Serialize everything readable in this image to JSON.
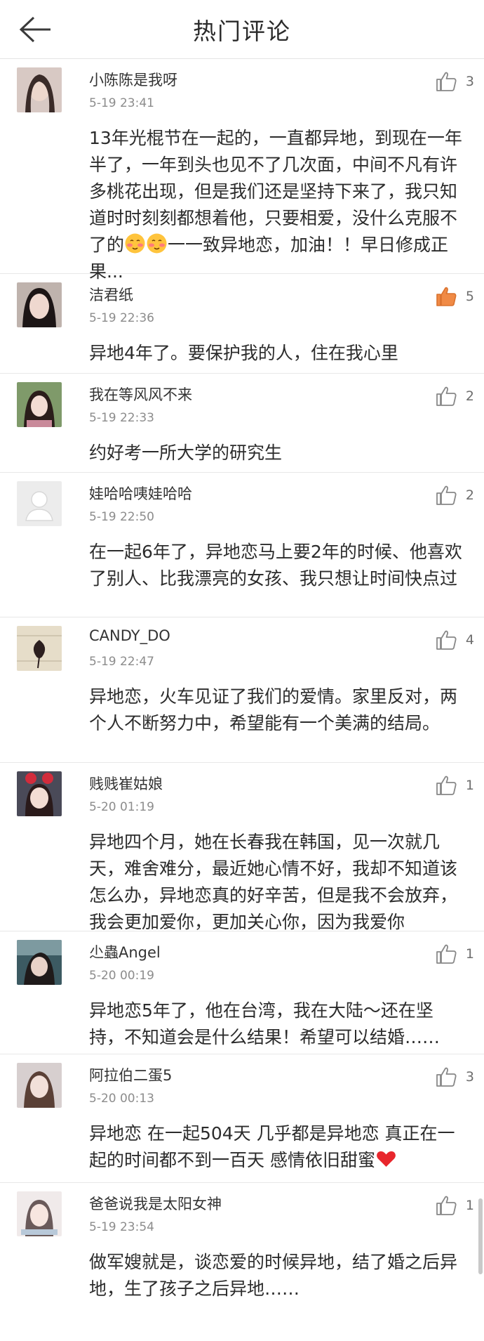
{
  "header": {
    "title": "热门评论"
  },
  "colors": {
    "like_active": "#f08a45",
    "like_inactive": "#888888"
  },
  "comments": [
    {
      "name": "小陈陈是我呀",
      "time": "5-19 23:41",
      "likes": "3",
      "liked": false,
      "text_a": "13年光棍节在一起的，一直都异地，到现在一年半了，一年到头也见不了几次面，中间不凡有许多桃花出现，但是我们还是坚持下来了，我只知道时时刻刻都想着他，只要相爱，没什么克服不了的",
      "text_b": "一一致异地恋，加油！！早日修成正果..."
    },
    {
      "name": "洁君纸",
      "time": "5-19 22:36",
      "likes": "5",
      "liked": true,
      "text": "异地4年了。要保护我的人，住在我心里"
    },
    {
      "name": "我在等风风不来",
      "time": "5-19 22:33",
      "likes": "2",
      "liked": false,
      "text": "约好考一所大学的研究生"
    },
    {
      "name": "娃哈哈咦娃哈哈",
      "time": "5-19 22:50",
      "likes": "2",
      "liked": false,
      "text": "在一起6年了，异地恋马上要2年的时候、他喜欢了别人、比我漂亮的女孩、我只想让时间快点过"
    },
    {
      "name": "CANDY_DO",
      "time": "5-19 22:47",
      "likes": "4",
      "liked": false,
      "text": "异地恋，火车见证了我们的爱情。家里反对，两个人不断努力中，希望能有一个美满的结局。"
    },
    {
      "name": "贱贱崔姑娘",
      "time": "5-20 01:19",
      "likes": "1",
      "liked": false,
      "text": "异地四个月，她在长春我在韩国，见一次就几天，难舍难分，最近她心情不好，我却不知道该怎么办，异地恋真的好辛苦，但是我不会放弃，我会更加爱你，更加关心你，因为我爱你"
    },
    {
      "name": "尐蟲Angel",
      "time": "5-20 00:19",
      "likes": "1",
      "liked": false,
      "text": "异地恋5年了，他在台湾，我在大陆～还在坚持，不知道会是什么结果！希望可以结婚……"
    },
    {
      "name": "阿拉伯二蛋5",
      "time": "5-20 00:13",
      "likes": "3",
      "liked": false,
      "text": "异地恋 在一起504天 几乎都是异地恋 真正在一起的时间都不到一百天 感情依旧甜蜜"
    },
    {
      "name": "爸爸说我是太阳女神",
      "time": "5-19 23:54",
      "likes": "1",
      "liked": false,
      "text": "做军嫂就是，谈恋爱的时候异地，结了婚之后异地，生了孩子之后异地……"
    }
  ]
}
